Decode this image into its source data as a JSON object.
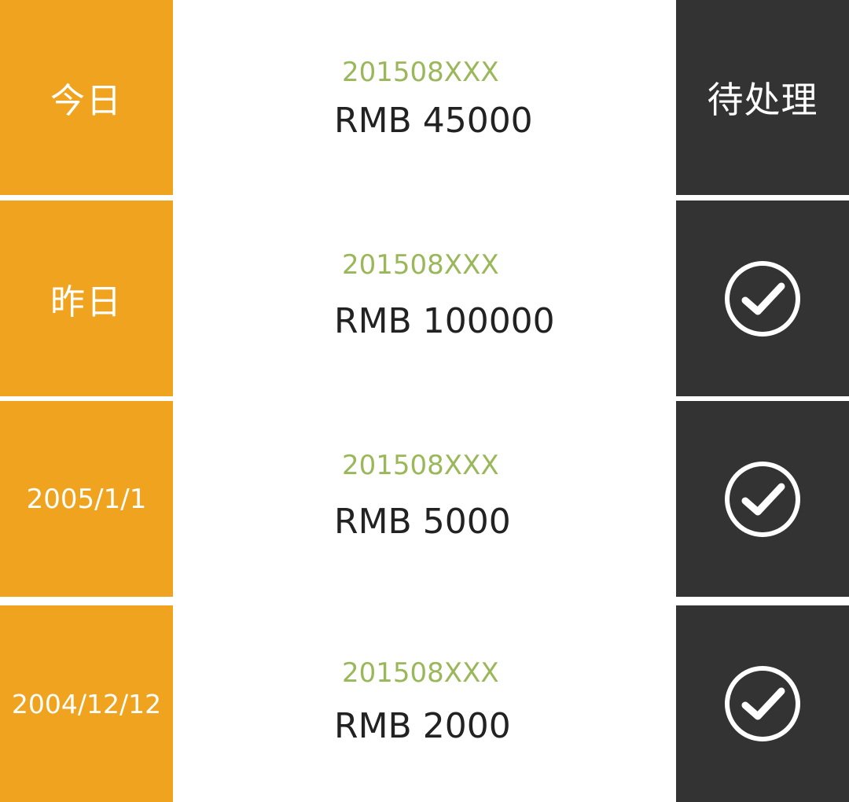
{
  "rows": [
    {
      "date": "今日",
      "order_id": "201508XXX",
      "amount": "RMB 45000",
      "status": "待处理",
      "status_icon": null
    },
    {
      "date": "昨日",
      "order_id": "201508XXX",
      "amount": "RMB 100000",
      "status": null,
      "status_icon": "check-circle-icon"
    },
    {
      "date": "2005/1/1",
      "order_id": "201508XXX",
      "amount": "RMB 5000",
      "status": null,
      "status_icon": "check-circle-icon"
    },
    {
      "date": "2004/12/12",
      "order_id": "201508XXX",
      "amount": "RMB 2000",
      "status": null,
      "status_icon": "check-circle-icon"
    }
  ],
  "colors": {
    "date_bg": "#f0a31e",
    "status_bg": "#333333",
    "order_id": "#9ab85a",
    "amount": "#222222"
  }
}
